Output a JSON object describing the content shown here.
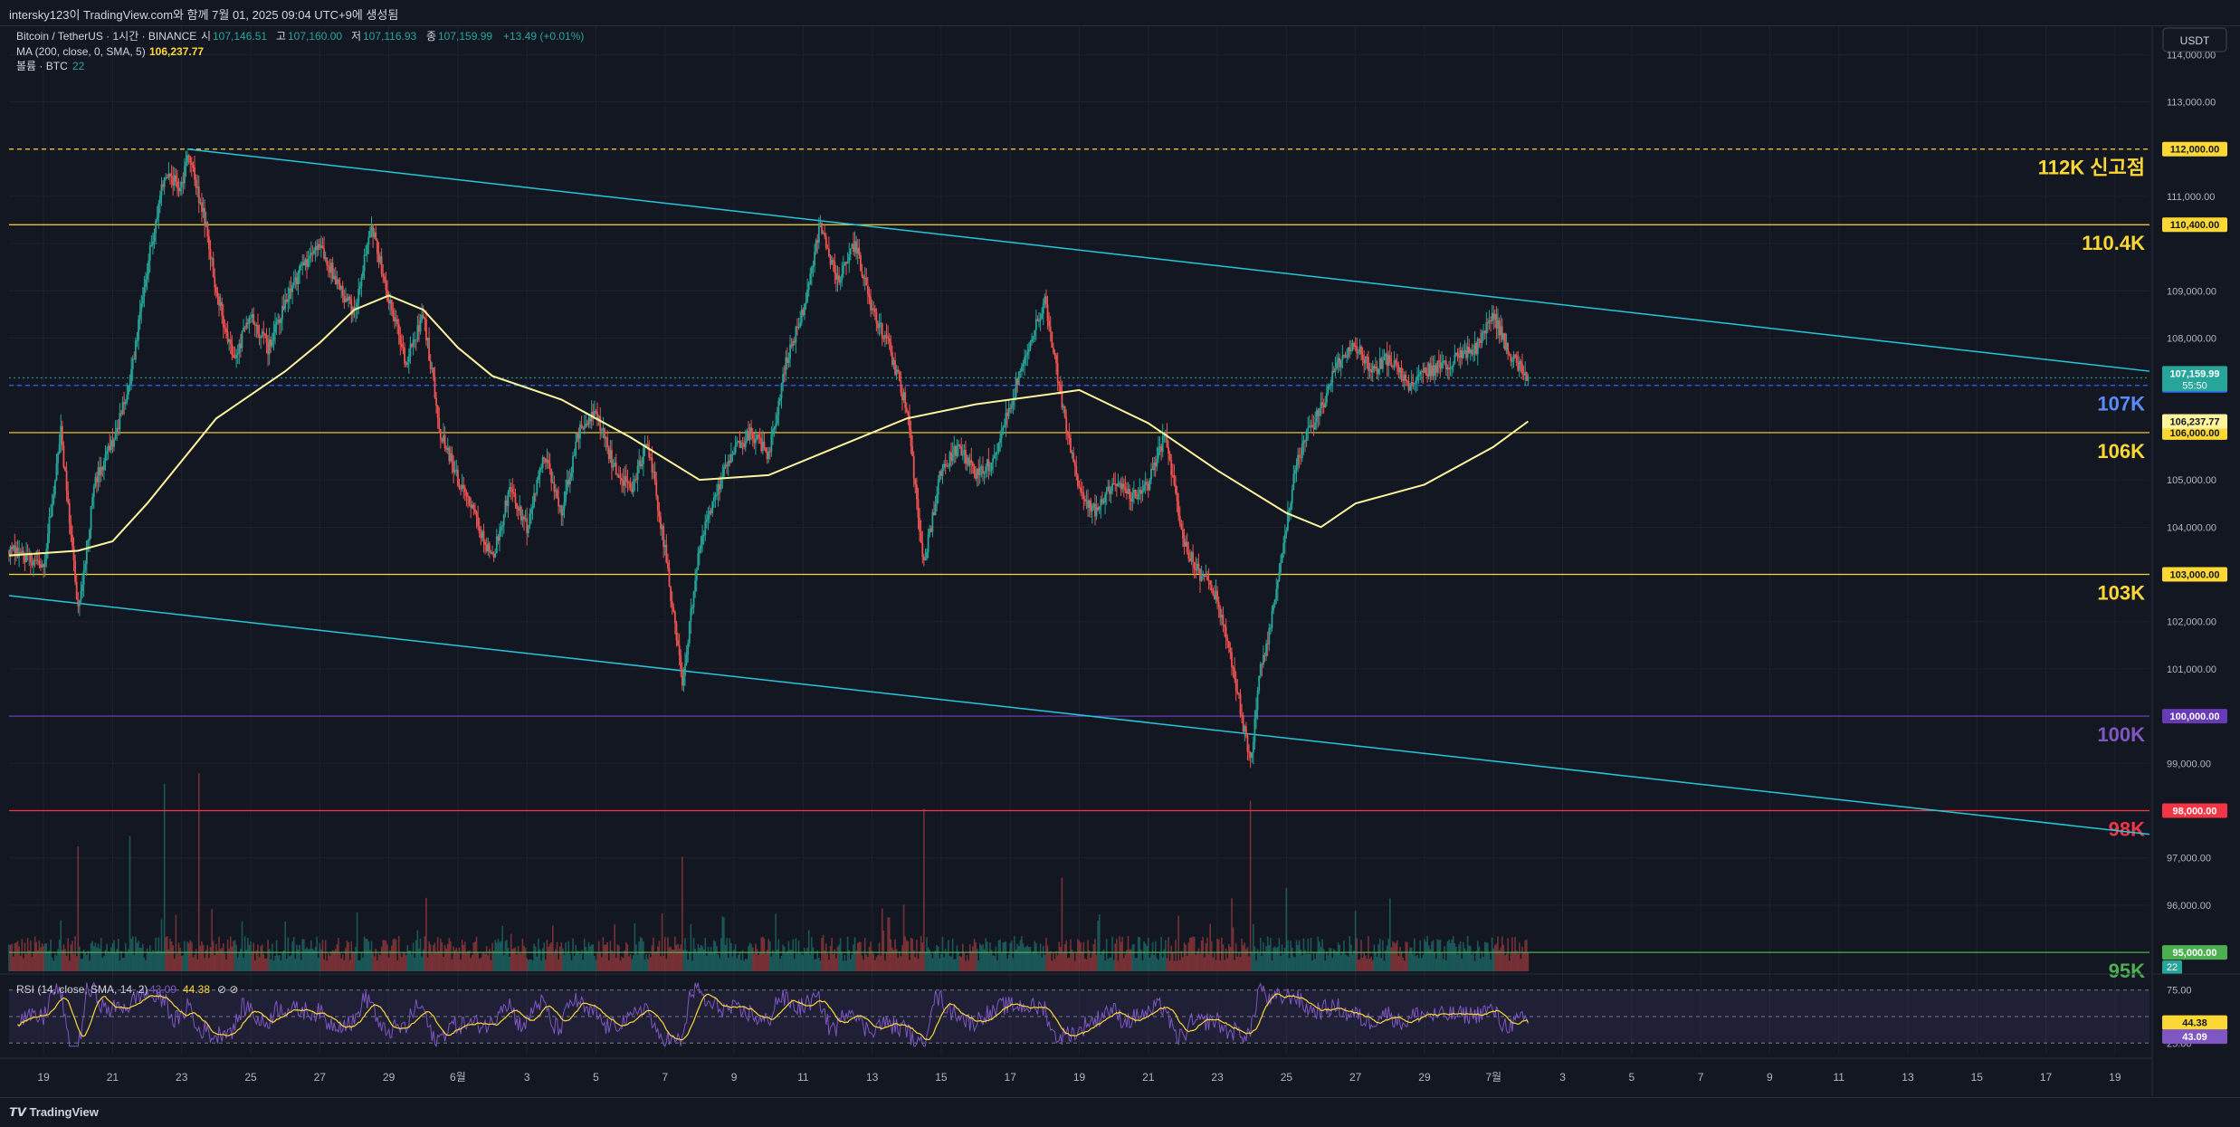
{
  "header": {
    "attribution": "intersky123이 TradingView.com와 함께 7월 01, 2025 09:04 UTC+9에 생성됨",
    "symbol": "Bitcoin / TetherUS · 1시간 · BINANCE",
    "ohlc": [
      {
        "label": "시",
        "value": "107,146.51"
      },
      {
        "label": "고",
        "value": "107,160.00"
      },
      {
        "label": "저",
        "value": "107,116.93"
      },
      {
        "label": "종",
        "value": "107,159.99"
      }
    ],
    "change": "+13.49 (+0.01%)",
    "ma_label": "MA (200, close, 0, SMA, 5)",
    "ma_value": "106,237.77",
    "volume_label": "볼륨 · BTC",
    "volume_value": "22",
    "currency": "USDT"
  },
  "footer": {
    "brand": "TradingView"
  },
  "chart_data": {
    "type": "line",
    "title": "Bitcoin / TetherUS · 1시간 · BINANCE",
    "ylim": [
      94600,
      114600
    ],
    "y_ticks": [
      "114,000.00",
      "113,000.00",
      "111,000.00",
      "109,000.00",
      "108,000.00",
      "105,000.00",
      "104,000.00",
      "102,000.00",
      "101,000.00",
      "99,000.00",
      "97,000.00",
      "96,000.00"
    ],
    "y_tick_values": [
      114000,
      113000,
      111000,
      109000,
      108000,
      105000,
      104000,
      102000,
      101000,
      99000,
      97000,
      96000
    ],
    "x_labels": [
      "19",
      "21",
      "23",
      "25",
      "27",
      "29",
      "6월",
      "3",
      "5",
      "7",
      "9",
      "11",
      "13",
      "15",
      "17",
      "19",
      "21",
      "23",
      "25",
      "27",
      "29",
      "7월",
      "3",
      "5",
      "7",
      "9",
      "11",
      "13",
      "15",
      "17",
      "19"
    ],
    "x_range": [
      "2025-05-18T00:00",
      "2025-07-19T00:00"
    ],
    "current_price": "107,159.99",
    "countdown": "55:50",
    "ma_current": "106,237.77",
    "levels": [
      {
        "price": 112000,
        "price_label": "112,000.00",
        "text": "112K 신고점",
        "color": "#fdd835",
        "dashed": true
      },
      {
        "price": 110400,
        "price_label": "110,400.00",
        "text": "110.4K",
        "color": "#fdd835",
        "dashed": false
      },
      {
        "price": 107000,
        "price_label": "107,000.00",
        "text": "107K",
        "color": "#2962ff",
        "dashed": true
      },
      {
        "price": 106000,
        "price_label": "106,000.00",
        "text": "106K",
        "color": "#fdd835",
        "dashed": false
      },
      {
        "price": 103000,
        "price_label": "103,000.00",
        "text": "103K",
        "color": "#fdd835",
        "dashed": false
      },
      {
        "price": 100000,
        "price_label": "100,000.00",
        "text": "100K",
        "color": "#673ab7",
        "dashed": false
      },
      {
        "price": 98000,
        "price_label": "98,000.00",
        "text": "98K",
        "color": "#f23645",
        "dashed": false
      },
      {
        "price": 95000,
        "price_label": "95,000.00",
        "text": "95K",
        "color": "#4caf50",
        "dashed": false
      }
    ],
    "trendlines": [
      {
        "from": [
          "2025-05-23T04:00",
          112000
        ],
        "to": [
          "2025-07-19T00:00",
          107300
        ]
      },
      {
        "from": [
          "2025-05-18T00:00",
          102550
        ],
        "to": [
          "2025-07-19T00:00",
          97500
        ]
      }
    ],
    "price_path": [
      [
        "2025-05-18T00:00",
        103500
      ],
      [
        "2025-05-19T00:00",
        103200
      ],
      [
        "2025-05-19T12:00",
        106000
      ],
      [
        "2025-05-20T00:00",
        102200
      ],
      [
        "2025-05-20T12:00",
        105000
      ],
      [
        "2025-05-21T00:00",
        105800
      ],
      [
        "2025-05-21T12:00",
        107000
      ],
      [
        "2025-05-22T00:00",
        109500
      ],
      [
        "2025-05-22T12:00",
        111500
      ],
      [
        "2025-05-23T00:00",
        111200
      ],
      [
        "2025-05-23T04:00",
        112000
      ],
      [
        "2025-05-23T16:00",
        110500
      ],
      [
        "2025-05-24T00:00",
        109000
      ],
      [
        "2025-05-24T12:00",
        107500
      ],
      [
        "2025-05-25T00:00",
        108500
      ],
      [
        "2025-05-25T12:00",
        107800
      ],
      [
        "2025-05-26T00:00",
        108800
      ],
      [
        "2025-05-26T12:00",
        109500
      ],
      [
        "2025-05-27T00:00",
        110000
      ],
      [
        "2025-05-27T12:00",
        109200
      ],
      [
        "2025-05-28T00:00",
        108500
      ],
      [
        "2025-05-28T12:00",
        110400
      ],
      [
        "2025-05-29T00:00",
        108800
      ],
      [
        "2025-05-29T12:00",
        107500
      ],
      [
        "2025-05-30T00:00",
        108500
      ],
      [
        "2025-05-30T12:00",
        106000
      ],
      [
        "2025-05-31T00:00",
        105000
      ],
      [
        "2025-05-31T12:00",
        104200
      ],
      [
        "2025-06-01T00:00",
        103300
      ],
      [
        "2025-06-01T12:00",
        104800
      ],
      [
        "2025-06-02T00:00",
        104000
      ],
      [
        "2025-06-02T12:00",
        105500
      ],
      [
        "2025-06-03T00:00",
        104300
      ],
      [
        "2025-06-03T12:00",
        106000
      ],
      [
        "2025-06-04T00:00",
        106400
      ],
      [
        "2025-06-04T12:00",
        105300
      ],
      [
        "2025-06-05T00:00",
        104800
      ],
      [
        "2025-06-05T12:00",
        105800
      ],
      [
        "2025-06-06T00:00",
        103500
      ],
      [
        "2025-06-06T12:00",
        100700
      ],
      [
        "2025-06-07T00:00",
        103600
      ],
      [
        "2025-06-07T12:00",
        104800
      ],
      [
        "2025-06-08T00:00",
        105600
      ],
      [
        "2025-06-08T12:00",
        106000
      ],
      [
        "2025-06-09T00:00",
        105500
      ],
      [
        "2025-06-09T12:00",
        107500
      ],
      [
        "2025-06-10T00:00",
        108600
      ],
      [
        "2025-06-10T12:00",
        110400
      ],
      [
        "2025-06-11T00:00",
        109200
      ],
      [
        "2025-06-11T12:00",
        110000
      ],
      [
        "2025-06-12T00:00",
        108600
      ],
      [
        "2025-06-12T12:00",
        107800
      ],
      [
        "2025-06-13T00:00",
        106500
      ],
      [
        "2025-06-13T12:00",
        103200
      ],
      [
        "2025-06-14T00:00",
        105200
      ],
      [
        "2025-06-14T12:00",
        105700
      ],
      [
        "2025-06-15T00:00",
        105100
      ],
      [
        "2025-06-15T12:00",
        105400
      ],
      [
        "2025-06-16T00:00",
        106600
      ],
      [
        "2025-06-16T12:00",
        107800
      ],
      [
        "2025-06-17T00:00",
        108800
      ],
      [
        "2025-06-17T12:00",
        106600
      ],
      [
        "2025-06-18T00:00",
        104800
      ],
      [
        "2025-06-18T12:00",
        104300
      ],
      [
        "2025-06-19T00:00",
        105000
      ],
      [
        "2025-06-19T12:00",
        104600
      ],
      [
        "2025-06-20T00:00",
        104900
      ],
      [
        "2025-06-20T12:00",
        106000
      ],
      [
        "2025-06-21T00:00",
        103700
      ],
      [
        "2025-06-21T12:00",
        103000
      ],
      [
        "2025-06-22T00:00",
        102500
      ],
      [
        "2025-06-22T12:00",
        100800
      ],
      [
        "2025-06-22T23:00",
        99000
      ],
      [
        "2025-06-23T06:00",
        101000
      ],
      [
        "2025-06-23T12:00",
        101800
      ],
      [
        "2025-06-23T22:00",
        103600
      ],
      [
        "2025-06-24T06:00",
        105200
      ],
      [
        "2025-06-24T12:00",
        105800
      ],
      [
        "2025-06-25T00:00",
        106500
      ],
      [
        "2025-06-25T12:00",
        107500
      ],
      [
        "2025-06-26T00:00",
        107800
      ],
      [
        "2025-06-26T12:00",
        107300
      ],
      [
        "2025-06-27T00:00",
        107600
      ],
      [
        "2025-06-27T12:00",
        107000
      ],
      [
        "2025-06-28T00:00",
        107300
      ],
      [
        "2025-06-28T12:00",
        107400
      ],
      [
        "2025-06-29T00:00",
        107600
      ],
      [
        "2025-06-29T12:00",
        107800
      ],
      [
        "2025-06-30T00:00",
        108500
      ],
      [
        "2025-06-30T12:00",
        107600
      ],
      [
        "2025-07-01T00:00",
        107159.99
      ]
    ],
    "ma_path": [
      [
        "2025-05-18T00:00",
        103400
      ],
      [
        "2025-05-20T00:00",
        103500
      ],
      [
        "2025-05-21T00:00",
        103700
      ],
      [
        "2025-05-22T00:00",
        104500
      ],
      [
        "2025-05-24T00:00",
        106300
      ],
      [
        "2025-05-26T00:00",
        107300
      ],
      [
        "2025-05-27T00:00",
        107900
      ],
      [
        "2025-05-28T00:00",
        108600
      ],
      [
        "2025-05-29T00:00",
        108900
      ],
      [
        "2025-05-30T00:00",
        108600
      ],
      [
        "2025-05-31T00:00",
        107800
      ],
      [
        "2025-06-01T00:00",
        107200
      ],
      [
        "2025-06-03T00:00",
        106700
      ],
      [
        "2025-06-05T00:00",
        105900
      ],
      [
        "2025-06-07T00:00",
        105000
      ],
      [
        "2025-06-09T00:00",
        105100
      ],
      [
        "2025-06-11T00:00",
        105700
      ],
      [
        "2025-06-13T00:00",
        106300
      ],
      [
        "2025-06-15T00:00",
        106600
      ],
      [
        "2025-06-17T00:00",
        106800
      ],
      [
        "2025-06-18T00:00",
        106900
      ],
      [
        "2025-06-20T00:00",
        106200
      ],
      [
        "2025-06-22T00:00",
        105200
      ],
      [
        "2025-06-24T00:00",
        104300
      ],
      [
        "2025-06-25T00:00",
        104000
      ],
      [
        "2025-06-26T00:00",
        104500
      ],
      [
        "2025-06-28T00:00",
        104900
      ],
      [
        "2025-06-29T00:00",
        105300
      ],
      [
        "2025-06-30T00:00",
        105700
      ],
      [
        "2025-07-01T00:00",
        106237.77
      ]
    ],
    "volume": {
      "label": "볼륨 · BTC",
      "current": "22",
      "spikes": [
        [
          "2025-05-20T00:00",
          0.6
        ],
        [
          "2025-05-21T12:00",
          0.65
        ],
        [
          "2025-05-22T12:00",
          0.9
        ],
        [
          "2025-05-23T12:00",
          0.95
        ],
        [
          "2025-06-06T12:00",
          0.55
        ],
        [
          "2025-06-13T12:00",
          0.78
        ],
        [
          "2025-06-17T12:00",
          0.45
        ],
        [
          "2025-06-22T23:00",
          0.82
        ],
        [
          "2025-06-24T00:00",
          0.4
        ],
        [
          "2025-06-27T00:00",
          0.35
        ]
      ]
    },
    "rsi": {
      "label": "RSI (14, close, SMA, 14, 2)",
      "rsi_value": "43.09",
      "sma_value": "44.38",
      "ticks": [
        "75.00",
        "25.00"
      ],
      "tick_values": [
        75,
        25
      ],
      "range": [
        15,
        85
      ]
    }
  }
}
